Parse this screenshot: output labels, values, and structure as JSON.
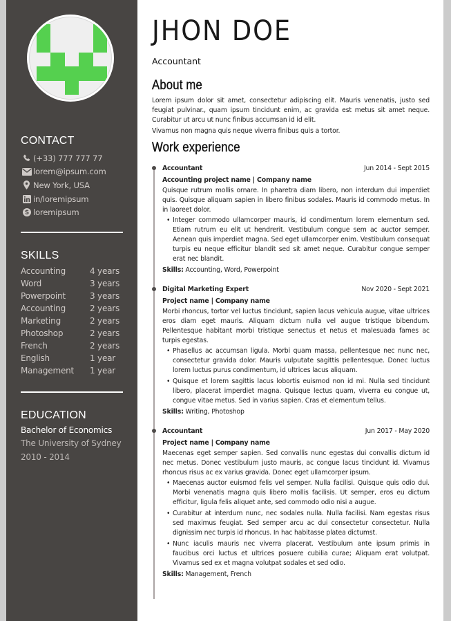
{
  "profile": {
    "name": "JHON DOE",
    "job_title": "Accountant",
    "avatar": {
      "type": "identicon",
      "color": "#55d04f",
      "background": "#efefef",
      "grid": [
        [
          1,
          0,
          0,
          0,
          1
        ],
        [
          1,
          0,
          0,
          0,
          1
        ],
        [
          0,
          1,
          0,
          1,
          0
        ],
        [
          1,
          1,
          1,
          1,
          1
        ],
        [
          0,
          0,
          1,
          0,
          0
        ]
      ]
    }
  },
  "sidebar": {
    "contact": {
      "title": "CONTACT",
      "items": [
        {
          "icon": "phone-icon",
          "text": "(+33) 777 777 77"
        },
        {
          "icon": "envelope-icon",
          "text": "lorem@ipsum.com"
        },
        {
          "icon": "map-marker-icon",
          "text": "New York, USA"
        },
        {
          "icon": "linkedin-icon",
          "text": "in/loremipsum"
        },
        {
          "icon": "skype-icon",
          "text": "loremipsum"
        }
      ]
    },
    "skills": {
      "title": "SKILLS",
      "items": [
        {
          "name": "Accounting",
          "duration": "4 years"
        },
        {
          "name": "Word",
          "duration": "3 years"
        },
        {
          "name": "Powerpoint",
          "duration": "3 years"
        },
        {
          "name": "Accounting",
          "duration": "2 years"
        },
        {
          "name": "Marketing",
          "duration": "2 years"
        },
        {
          "name": "Photoshop",
          "duration": "2 years"
        },
        {
          "name": "French",
          "duration": "2 years"
        },
        {
          "name": "English",
          "duration": "1 year"
        },
        {
          "name": "Management",
          "duration": "1 year"
        }
      ]
    },
    "education": {
      "title": "EDUCATION",
      "degree": "Bachelor of Economics",
      "school": "The University of Sydney",
      "years": "2010 - 2014"
    }
  },
  "about": {
    "title": "About me",
    "paragraphs": [
      "Lorem ipsum dolor sit amet, consectetur adipiscing elit. Mauris venenatis, justo sed feugiat pulvinar., quam ipsum tincidunt enim, ac gravida est metus sit amet neque. Curabitur ut arcu ut nunc finibus accumsan id id elit.",
      "Vivamus non magna quis neque viverra finibus quis a tortor."
    ]
  },
  "work": {
    "title": "Work experience",
    "skills_label": "Skills:",
    "jobs": [
      {
        "role": "Accountant",
        "dates": "Jun 2014 - Sept 2015",
        "project": "Accounting project name | Company name",
        "description": "Quisque rutrum mollis ornare. In pharetra diam libero, non interdum dui imperdiet quis. Quisque aliquam sapien in libero finibus sodales. Mauris id commodo metus. In in laoreet dolor.",
        "bullets": [
          "Integer commodo ullamcorper mauris, id condimentum lorem elementum sed. Etiam rutrum eu elit ut hendrerit. Vestibulum congue sem ac auctor semper. Aenean quis imperdiet magna. Sed eget ullamcorper enim. Vestibulum consequat turpis eu neque efficitur blandit sed sit amet neque. Curabitur congue semper erat nec blandit."
        ],
        "skills": "Accounting, Word, Powerpoint"
      },
      {
        "role": "Digital Marketing Expert",
        "dates": "Nov 2020 - Sept 2021",
        "project": "Project name | Company name",
        "description": "Morbi rhoncus, tortor vel luctus tincidunt, sapien lacus vehicula augue, vitae ultrices eros diam eget mauris. Aliquam dictum nulla vel augue tristique bibendum. Pellentesque habitant morbi tristique senectus et netus et malesuada fames ac turpis egestas.",
        "bullets": [
          "Phasellus ac accumsan ligula. Morbi quam massa, pellentesque nec nunc nec, consectetur gravida dolor. Mauris vulputate sagittis pellentesque. Donec luctus lorem luctus purus condimentum, id ultrices lacus aliquam.",
          "Quisque et lorem sagittis lacus lobortis euismod non id mi. Nulla sed tincidunt libero, placerat imperdiet magna. Quisque lectus quam, viverra eu congue ut, congue vitae metus. Sed in varius sapien. Cras et elementum tellus."
        ],
        "skills": "Writing, Photoshop"
      },
      {
        "role": "Accountant",
        "dates": "Jun 2017 - May 2020",
        "project": "Project name | Company name",
        "description": "Maecenas eget semper sapien. Sed convallis nunc egestas dui convallis dictum id nec metus. Donec vestibulum justo mauris, ac congue lacus tincidunt id. Vivamus rhoncus risus ac ex varius gravida. Donec eget ullamcorper ipsum.",
        "bullets": [
          "Maecenas auctor euismod felis vel semper. Nulla facilisi. Quisque quis odio dui. Morbi venenatis magna quis libero mollis facilisis. Ut semper, eros eu dictum efficitur, ligula felis aliquet ante, sed commodo odio nisi a augue.",
          "Curabitur at interdum nunc, nec sodales nulla. Nulla facilisi. Nam egestas risus sed maximus feugiat. Sed semper arcu ac dui consectetur consectetur. Nulla dignissim nec turpis id rhoncus. In hac habitasse platea dictumst.",
          "Nunc iaculis mauris nec viverra placerat. Vestibulum ante ipsum primis in faucibus orci luctus et ultrices posuere cubilia curae; Aliquam erat volutpat. Vivamus sed ex et magna volutpat sodales et sed odio."
        ],
        "skills": "Management, French"
      }
    ]
  },
  "colors": {
    "sidebar_bg": "#484543",
    "accent_green": "#55d04f",
    "timeline": "#aaa3a3",
    "page_border": "#cccccc"
  }
}
